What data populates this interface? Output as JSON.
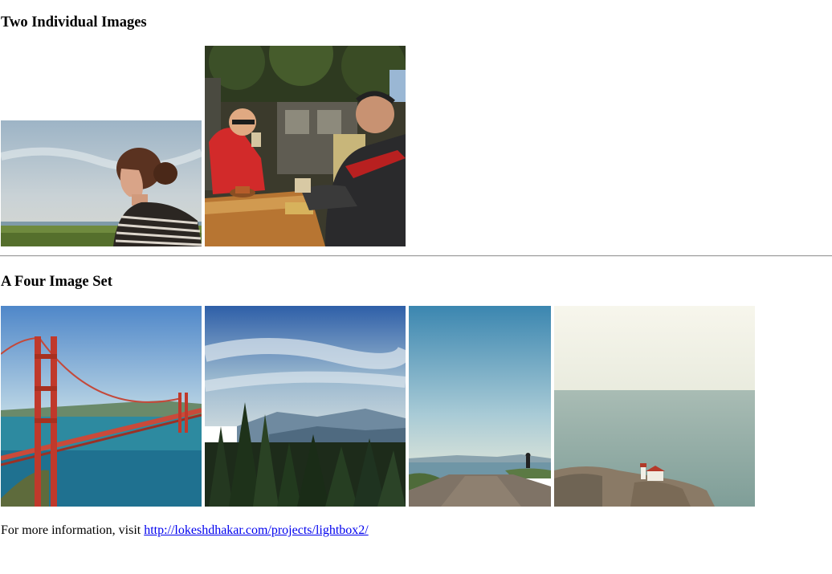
{
  "sections": {
    "two_individual": {
      "heading": "Two Individual Images"
    },
    "four_image_set": {
      "heading": "A Four Image Set"
    }
  },
  "footer": {
    "prefix": "For more information, visit ",
    "link_text": "http://lokeshdhakar.com/projects/lightbox2/"
  },
  "images": {
    "woman_by_sea": {
      "icon": "photo-woman-looking-at-sea"
    },
    "cyclists_cafe": {
      "icon": "photo-two-cyclists-drinking-coffee"
    },
    "golden_gate": {
      "icon": "photo-golden-gate-bridge"
    },
    "forest_mountains": {
      "icon": "photo-forest-and-mountains"
    },
    "coastal_road": {
      "icon": "photo-coastal-road-with-person"
    },
    "lighthouse_coast": {
      "icon": "photo-lighthouse-on-cliff"
    }
  }
}
